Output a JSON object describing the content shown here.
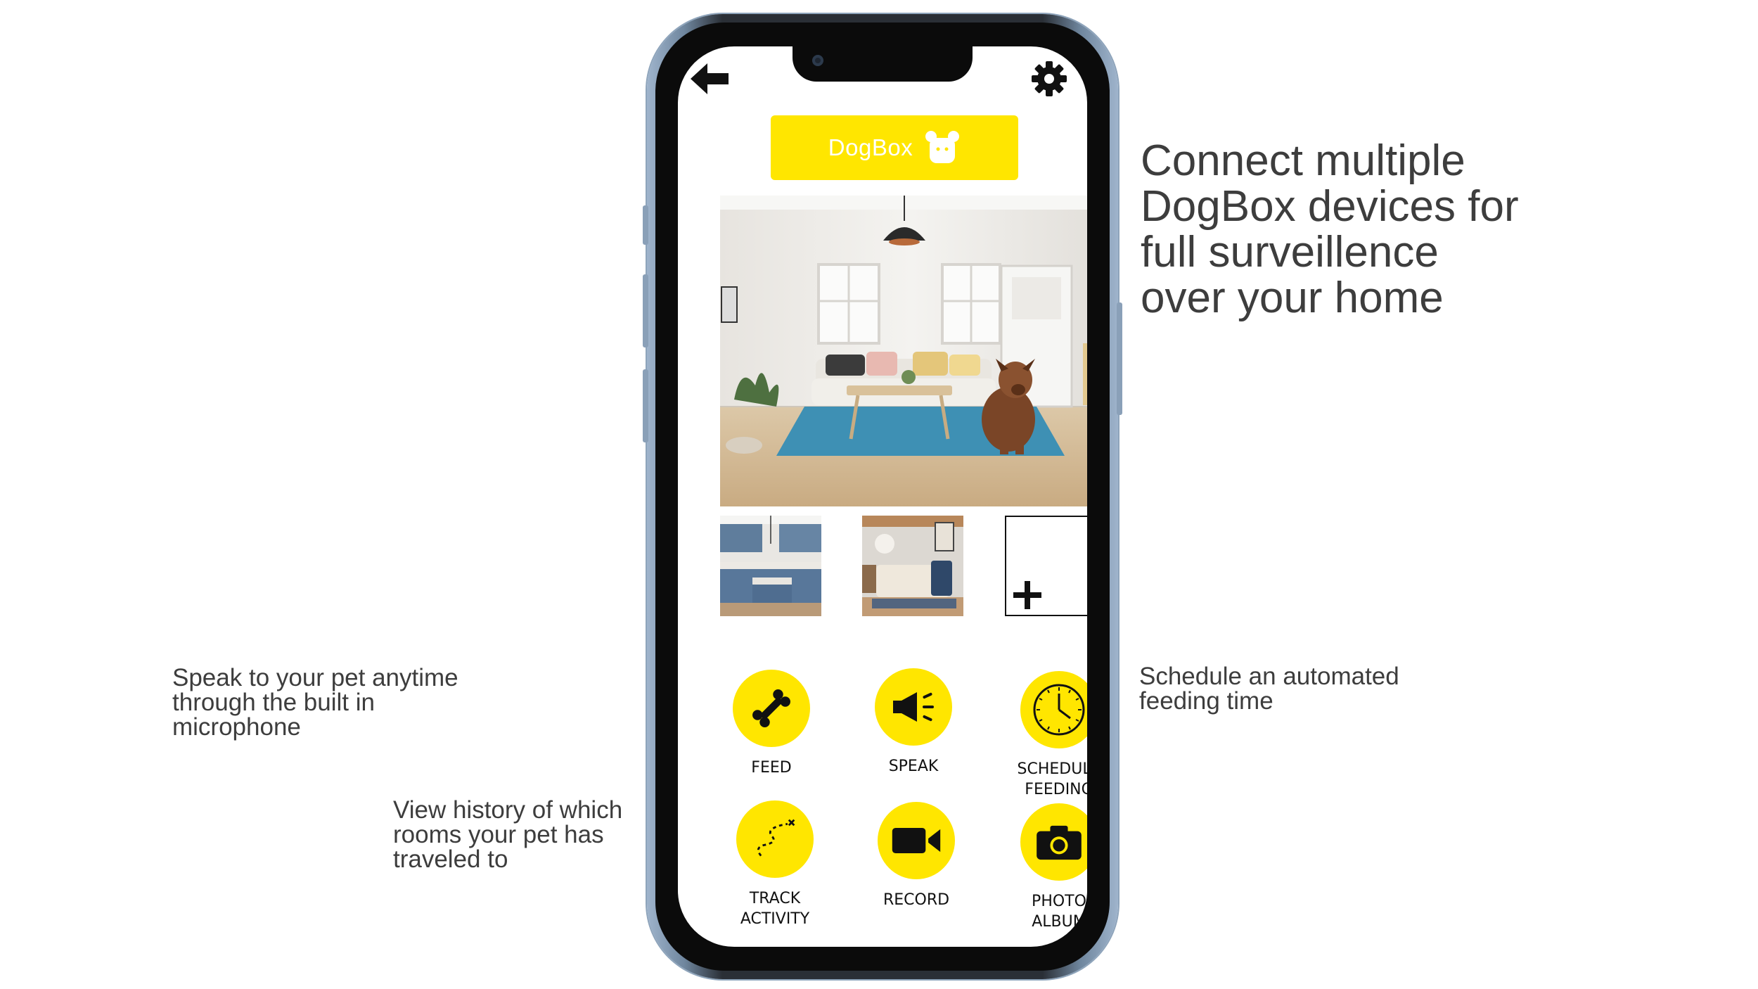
{
  "notes": {
    "connect": "Connect multiple\nDogBox devices for\nfull surveillence\nover your home",
    "speak": "Speak to your pet anytime\nthrough the built in\nmicrophone",
    "track": "View history of which\nrooms your pet has\ntraveled to",
    "schedule": "Schedule an automated\nfeeding time"
  },
  "app": {
    "brand": "DogBox",
    "actions": [
      {
        "label": "FEED",
        "icon": "bone-icon"
      },
      {
        "label": "SPEAK",
        "icon": "megaphone-icon"
      },
      {
        "label": "SCHEDULE\nFEEDING",
        "icon": "clock-icon"
      },
      {
        "label": "TRACK\nACTIVITY",
        "icon": "path-icon"
      },
      {
        "label": "RECORD",
        "icon": "video-camera-icon"
      },
      {
        "label": "PHOTO\nALBUM",
        "icon": "camera-icon"
      }
    ]
  },
  "colors": {
    "accent": "#ffe600",
    "frame": "#2a2f36",
    "text": "#3d3d3d"
  }
}
